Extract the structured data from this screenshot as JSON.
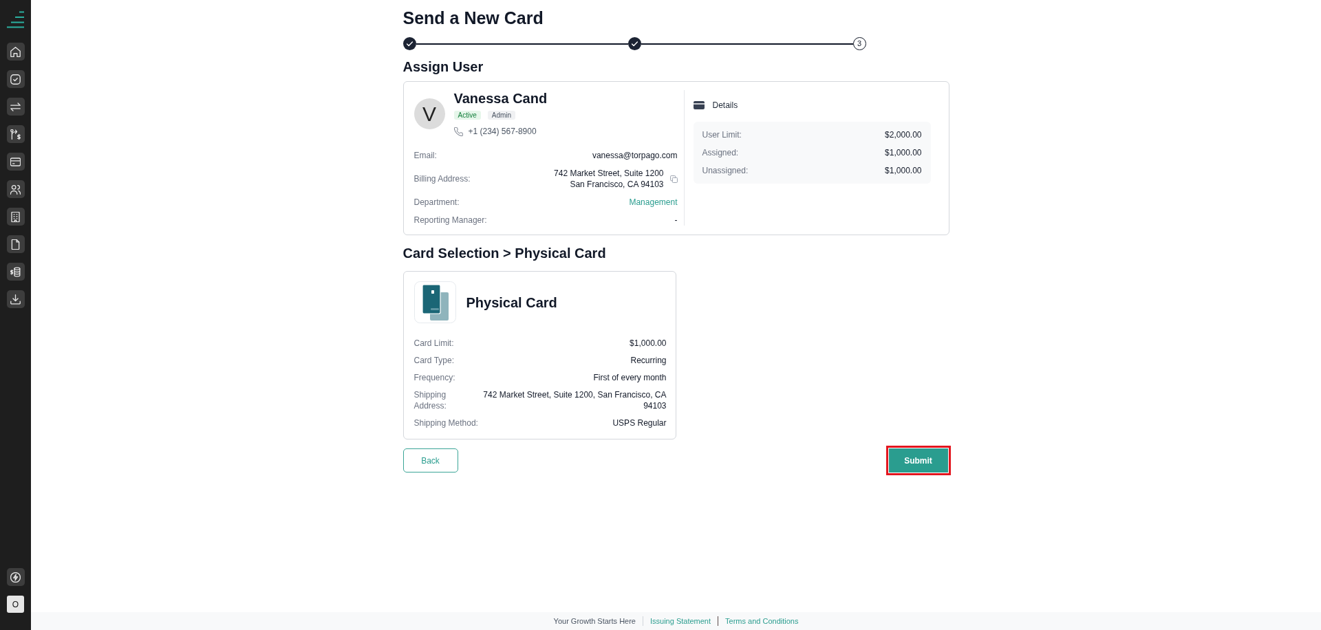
{
  "sidebar": {
    "avatar": "O"
  },
  "header": {
    "title": "Send a New Card"
  },
  "stepper": {
    "steps": [
      {
        "done": true
      },
      {
        "done": true
      },
      {
        "done": false,
        "label": "3"
      }
    ]
  },
  "assign_user": {
    "heading": "Assign User",
    "avatar_initial": "V",
    "name": "Vanessa Cand",
    "badges": [
      {
        "text": "Active",
        "kind": "status"
      },
      {
        "text": "Admin",
        "kind": "role"
      }
    ],
    "phone": "+1 (234) 567-8900",
    "fields": [
      {
        "kind": "text",
        "label": "Email:",
        "value": "vanessa@torpago.com"
      },
      {
        "kind": "address",
        "label": "Billing Address:",
        "lines": [
          "742 Market Street, Suite 1200",
          "San Francisco, CA 94103"
        ]
      },
      {
        "kind": "link",
        "label": "Department:",
        "value": "Management"
      },
      {
        "kind": "text",
        "label": "Reporting Manager:",
        "value": "-"
      }
    ],
    "details": {
      "title": "Details",
      "rows": [
        {
          "label": "User Limit:",
          "value": "$2,000.00"
        },
        {
          "label": "Assigned:",
          "value": "$1,000.00"
        },
        {
          "label": "Unassigned:",
          "value": "$1,000.00"
        }
      ]
    }
  },
  "card_selection": {
    "heading": "Card Selection > Physical Card",
    "card": {
      "name": "Physical Card",
      "fields": [
        {
          "kind": "text",
          "label": "Card Limit:",
          "value": "$1,000.00"
        },
        {
          "kind": "text",
          "label": "Card Type:",
          "value": "Recurring"
        },
        {
          "kind": "text",
          "label": "Frequency:",
          "value": "First of every month"
        },
        {
          "kind": "wrapped",
          "label": "Shipping Address:",
          "value": "742 Market Street, Suite 1200, San Francisco, CA 94103"
        },
        {
          "kind": "text",
          "label": "Shipping Method:",
          "value": "USPS Regular"
        }
      ]
    }
  },
  "actions": {
    "back": {
      "label": "Back"
    },
    "submit": {
      "label": "Submit",
      "highlighted": true
    }
  },
  "footer": {
    "items": [
      {
        "kind": "tagline",
        "text": "Your Growth Starts Here"
      },
      {
        "kind": "link",
        "text": "Issuing Statement"
      },
      {
        "kind": "link",
        "text": "Terms and Conditions"
      }
    ]
  }
}
